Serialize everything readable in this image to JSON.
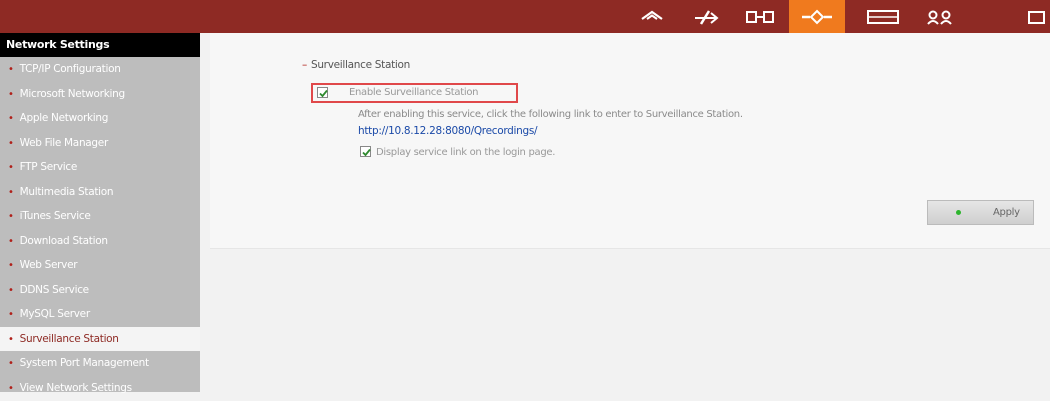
{
  "topbar": {
    "nav_icons": [
      "home-icon",
      "network-icon",
      "devices-icon",
      "applications-icon",
      "disk-icon",
      "users-icon",
      "folder-icon"
    ],
    "active_icon": "applications-icon",
    "colors": {
      "bar": "#8e2a24",
      "active": "#f07a1e"
    }
  },
  "sidebar": {
    "title": "Network Settings",
    "items": [
      {
        "label": "TCP/IP Configuration"
      },
      {
        "label": "Microsoft Networking"
      },
      {
        "label": "Apple Networking"
      },
      {
        "label": "Web File Manager"
      },
      {
        "label": "FTP Service"
      },
      {
        "label": "Multimedia Station"
      },
      {
        "label": "iTunes Service"
      },
      {
        "label": "Download Station"
      },
      {
        "label": "Web Server"
      },
      {
        "label": "DDNS Service"
      },
      {
        "label": "MySQL Server"
      },
      {
        "label": "Surveillance Station",
        "active": true
      },
      {
        "label": "System Port Management"
      },
      {
        "label": "View Network Settings"
      }
    ]
  },
  "main": {
    "section_title": "Surveillance Station",
    "enable_label": "Enable Surveillance Station",
    "enable_checked": true,
    "description": "After enabling this service, click the following link to enter to Surveillance Station.",
    "link": "http://10.8.12.28:8080/Qrecordings/",
    "display_link_label": "Display service link on the login page.",
    "display_link_checked": true,
    "apply_label": "Apply"
  }
}
